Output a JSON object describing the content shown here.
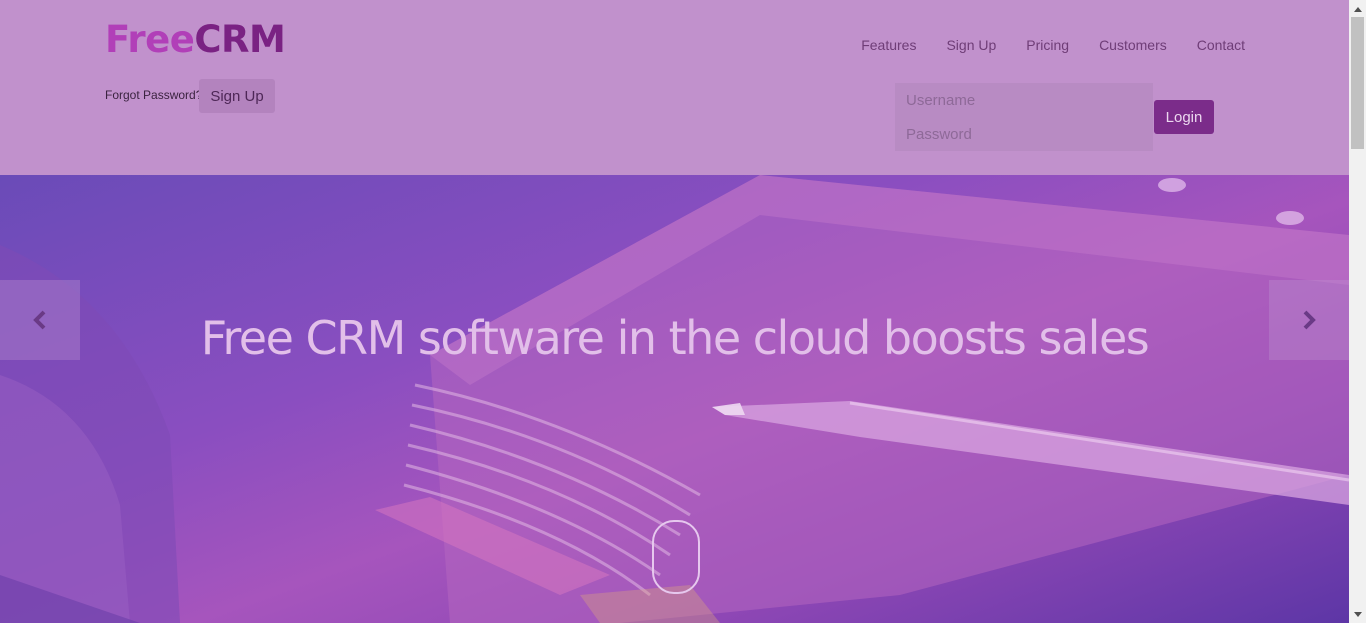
{
  "brand": {
    "free": "Free",
    "crm": "CRM"
  },
  "nav": {
    "items": [
      "Features",
      "Sign Up",
      "Pricing",
      "Customers",
      "Contact"
    ]
  },
  "login": {
    "forgot_label": "Forgot Password?",
    "signup_label": "Sign Up",
    "username_placeholder": "Username",
    "password_placeholder": "Password",
    "login_label": "Login"
  },
  "hero": {
    "title": "Free CRM software in the cloud boosts sales",
    "prev_icon": "chevron-left-icon",
    "next_icon": "chevron-right-icon",
    "scroll_icon": "mouse-scroll-icon"
  },
  "colors": {
    "header_bg": "#c191cc",
    "accent": "#7b2c8a",
    "logo_free": "#b13fb8",
    "logo_crm": "#7a2283"
  }
}
